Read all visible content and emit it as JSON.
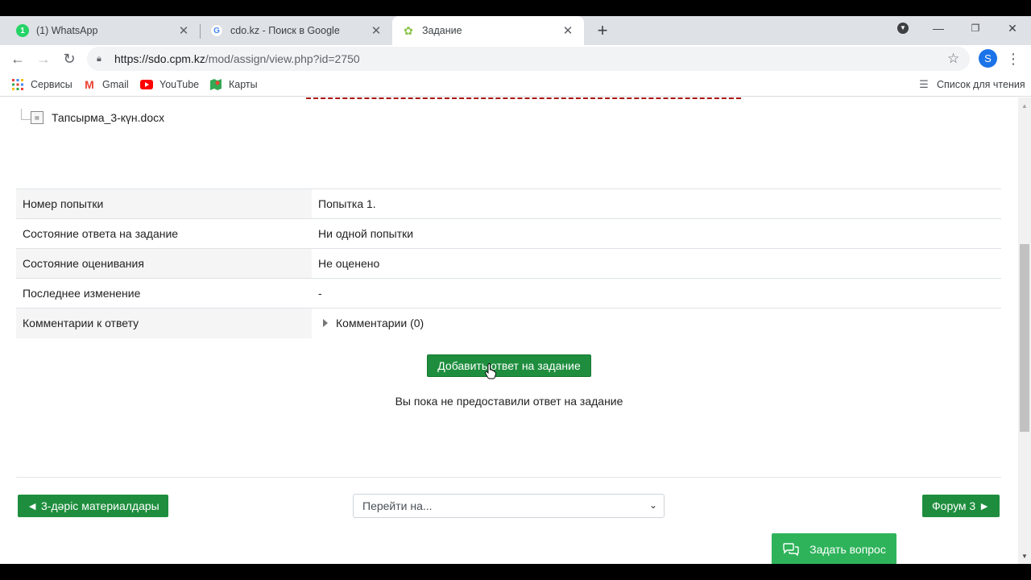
{
  "browser": {
    "tabs": [
      {
        "title": "(1) WhatsApp",
        "favicon": "whatsapp-icon",
        "favicon_text": "1",
        "color": "#25d366"
      },
      {
        "title": "cdo.kz - Поиск в Google",
        "favicon": "google-icon",
        "favicon_text": "G",
        "color": "#4285f4"
      },
      {
        "title": "Задание",
        "favicon": "moodle-icon",
        "favicon_text": "",
        "color": "#8bc34a"
      }
    ],
    "url_host": "https://sdo.cpm.kz",
    "url_path": "/mod/assign/view.php?id=2750",
    "profile_initial": "S",
    "bookmarks": [
      {
        "label": "Сервисы",
        "icon": "apps-grid-icon"
      },
      {
        "label": "Gmail",
        "icon": "gmail-icon"
      },
      {
        "label": "YouTube",
        "icon": "youtube-icon"
      },
      {
        "label": "Карты",
        "icon": "maps-icon"
      }
    ],
    "reading_list": "Список для чтения"
  },
  "assignment": {
    "file_name": "Тапсырма_3-күн.docx",
    "status_rows": [
      {
        "label": "Номер попытки",
        "value": "Попытка 1."
      },
      {
        "label": "Состояние ответа на задание",
        "value": "Ни одной попытки"
      },
      {
        "label": "Состояние оценивания",
        "value": "Не оценено"
      },
      {
        "label": "Последнее изменение",
        "value": "-"
      },
      {
        "label": "Комментарии к ответу",
        "value": "Комментарии (0)"
      }
    ],
    "submit_button": "Добавить ответ на задание",
    "not_submitted_text": "Вы пока не предоставили ответ на задание"
  },
  "navigation": {
    "prev_label": "◄ 3-дәріс материалдары",
    "jump_placeholder": "Перейти на...",
    "next_label": "Форум 3 ►",
    "ask_label": "Задать вопрос"
  },
  "colors": {
    "accent_green": "#1e8e3e",
    "chat_green": "#2eb35a"
  }
}
